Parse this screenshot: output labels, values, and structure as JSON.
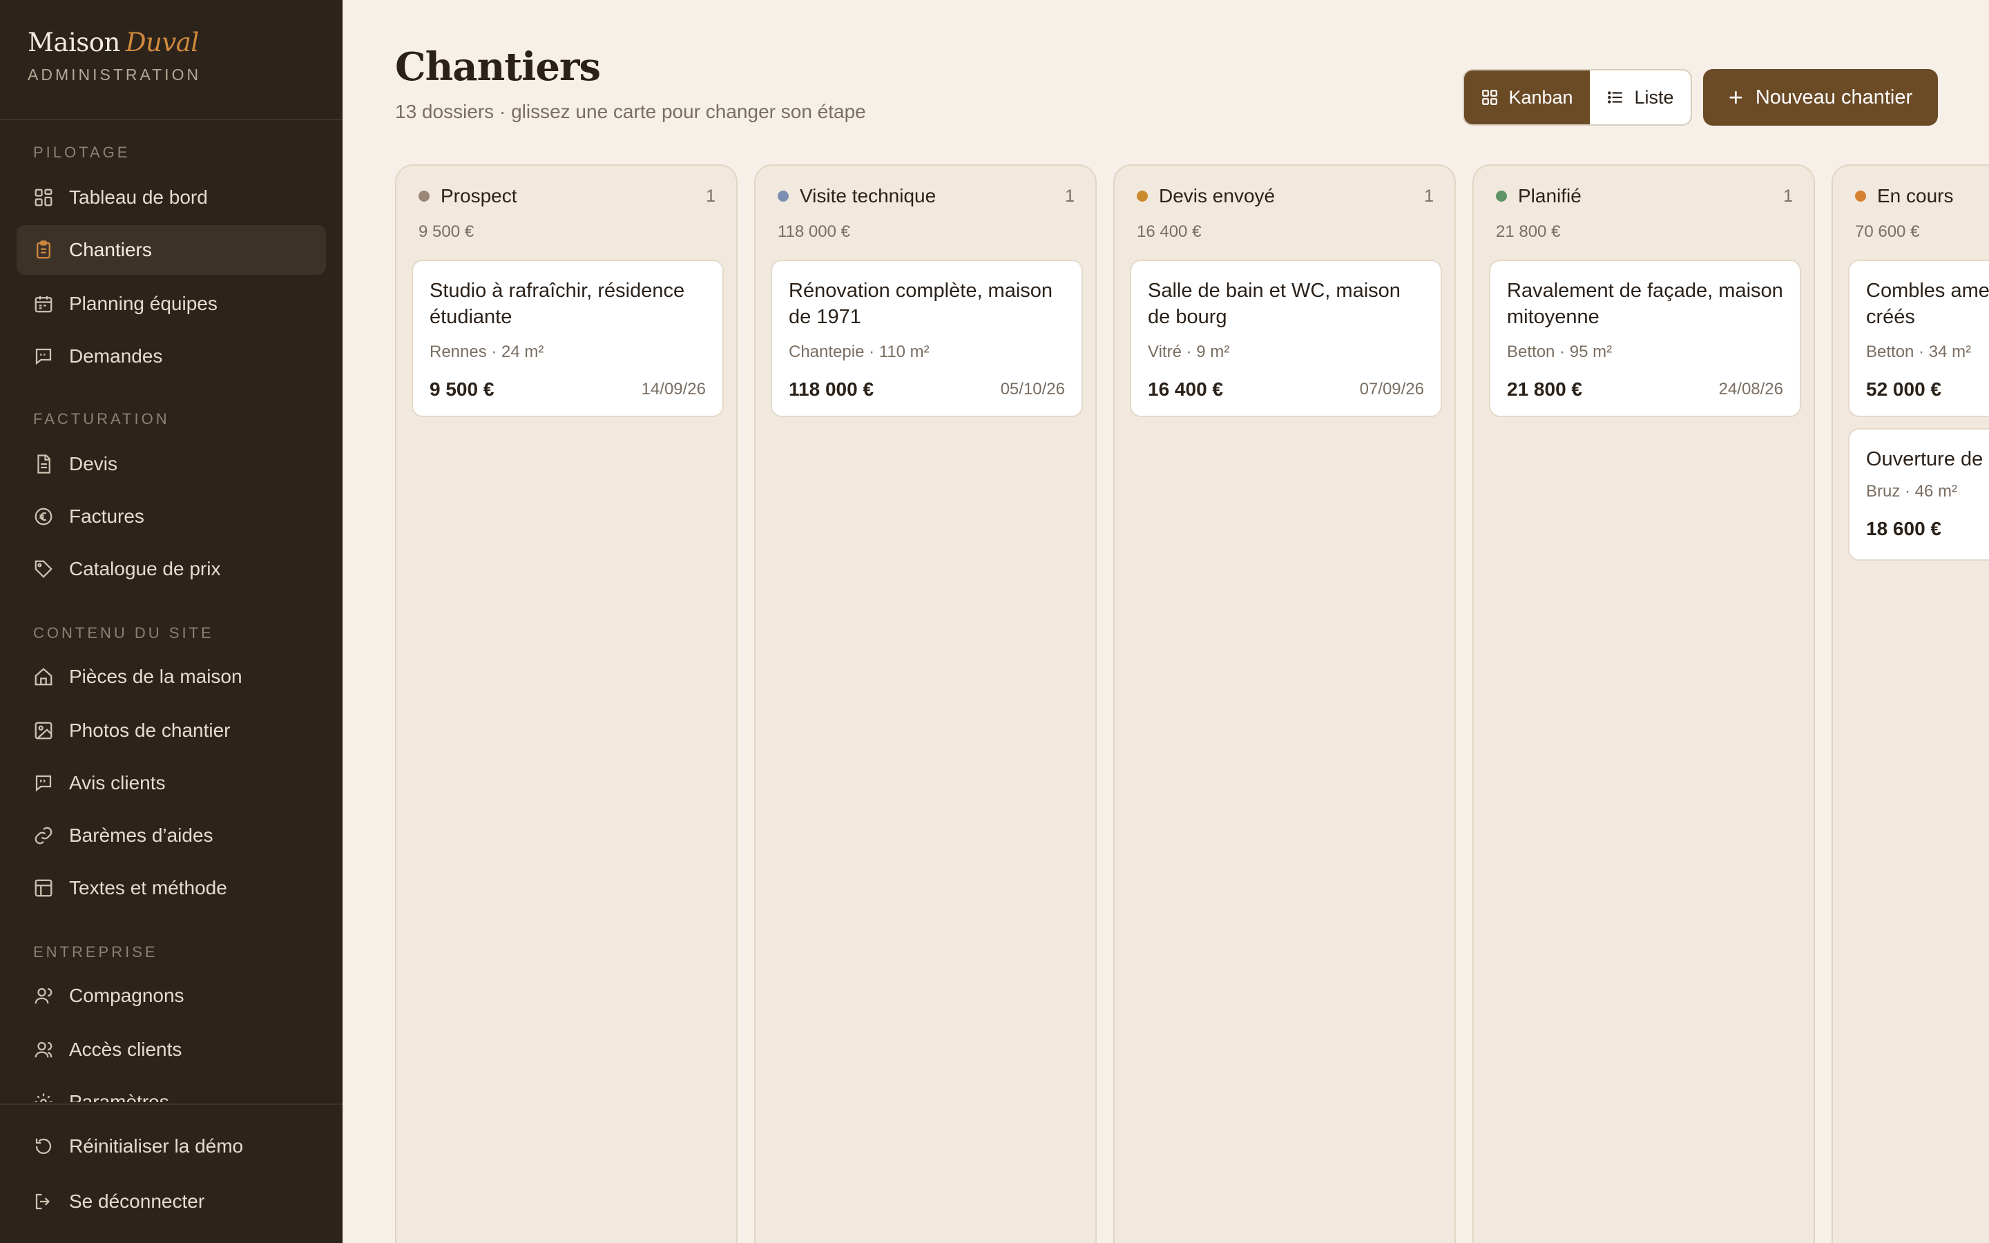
{
  "brand": {
    "name": "Maison",
    "accent": "Duval",
    "subtitle": "ADMINISTRATION"
  },
  "nav": {
    "sections": [
      {
        "title": "PILOTAGE",
        "items": [
          {
            "label": "Tableau de bord",
            "icon": "dashboard-icon"
          },
          {
            "label": "Chantiers",
            "icon": "clipboard-icon",
            "active": true
          },
          {
            "label": "Planning équipes",
            "icon": "calendar-icon"
          },
          {
            "label": "Demandes",
            "icon": "message-icon"
          }
        ]
      },
      {
        "title": "FACTURATION",
        "items": [
          {
            "label": "Devis",
            "icon": "document-icon"
          },
          {
            "label": "Factures",
            "icon": "euro-icon"
          },
          {
            "label": "Catalogue de prix",
            "icon": "tag-icon"
          }
        ]
      },
      {
        "title": "CONTENU DU SITE",
        "items": [
          {
            "label": "Pièces de la maison",
            "icon": "home-icon"
          },
          {
            "label": "Photos de chantier",
            "icon": "image-icon"
          },
          {
            "label": "Avis clients",
            "icon": "quote-icon"
          },
          {
            "label": "Barèmes d’aides",
            "icon": "link-icon"
          },
          {
            "label": "Textes et méthode",
            "icon": "layout-icon"
          }
        ]
      },
      {
        "title": "ENTREPRISE",
        "items": [
          {
            "label": "Compagnons",
            "icon": "user-icon"
          },
          {
            "label": "Accès clients",
            "icon": "users-icon"
          },
          {
            "label": "Paramètres",
            "icon": "gear-icon"
          }
        ]
      }
    ],
    "footer": [
      {
        "label": "Réinitialiser la démo",
        "icon": "reset-icon"
      },
      {
        "label": "Se déconnecter",
        "icon": "logout-icon"
      }
    ]
  },
  "page": {
    "title": "Chantiers",
    "subtitle": "13 dossiers · glissez une carte pour changer son étape"
  },
  "toolbar": {
    "kanban_label": "Kanban",
    "liste_label": "Liste",
    "new_label": "Nouveau chantier",
    "active_view": "Kanban"
  },
  "colors": {
    "accent": "#6b4a26",
    "sidebar": "#2c231b",
    "background": "#f6f0e8"
  },
  "columns": [
    {
      "name": "Prospect",
      "count": "1",
      "total": "9 500 €",
      "dot": "#9a8676",
      "cards": [
        {
          "title": "Studio à rafraîchir, résidence étudiante",
          "meta": "Rennes · 24 m²",
          "price": "9 500 €",
          "date": "14/09/26"
        }
      ]
    },
    {
      "name": "Visite technique",
      "count": "1",
      "total": "118 000 €",
      "dot": "#7d8fb0",
      "cards": [
        {
          "title": "Rénovation complète, maison de 1971",
          "meta": "Chantepie · 110 m²",
          "price": "118 000 €",
          "date": "05/10/26"
        }
      ]
    },
    {
      "name": "Devis envoyé",
      "count": "1",
      "total": "16 400 €",
      "dot": "#c98a2e",
      "cards": [
        {
          "title": "Salle de bain et WC, maison de bourg",
          "meta": "Vitré · 9 m²",
          "price": "16 400 €",
          "date": "07/09/26"
        }
      ]
    },
    {
      "name": "Planifié",
      "count": "1",
      "total": "21 800 €",
      "dot": "#5f9466",
      "cards": [
        {
          "title": "Ravalement de façade, maison mitoyenne",
          "meta": "Betton · 95 m²",
          "price": "21 800 €",
          "date": "24/08/26"
        }
      ]
    },
    {
      "name": "En cours",
      "count": "",
      "total": "70 600 €",
      "dot": "#d57f2f",
      "cards": [
        {
          "title": "Combles ame… créés",
          "meta": "Betton · 34 m²",
          "price": "52 000 €",
          "date": ""
        },
        {
          "title": "Ouverture de",
          "meta": "Bruz · 46 m²",
          "price": "18 600 €",
          "date": ""
        }
      ]
    }
  ]
}
